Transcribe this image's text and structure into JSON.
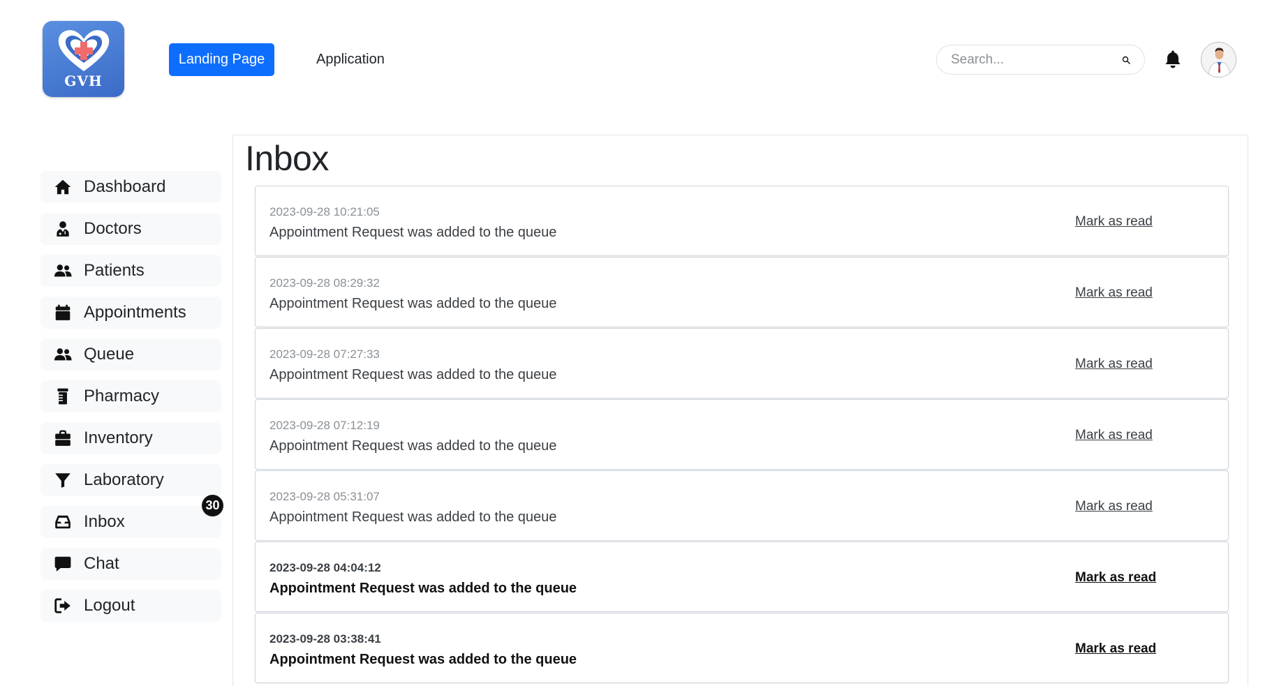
{
  "brand": {
    "logo_text": "GVH"
  },
  "topnav": {
    "landing_label": "Landing Page",
    "application_label": "Application"
  },
  "search": {
    "placeholder": "Search..."
  },
  "sidebar": {
    "items": [
      {
        "label": "Dashboard",
        "icon": "home-icon"
      },
      {
        "label": "Doctors",
        "icon": "doctor-icon"
      },
      {
        "label": "Patients",
        "icon": "users-icon"
      },
      {
        "label": "Appointments",
        "icon": "calendar-icon"
      },
      {
        "label": "Queue",
        "icon": "users-icon"
      },
      {
        "label": "Pharmacy",
        "icon": "prescription-bottle-icon"
      },
      {
        "label": "Inventory",
        "icon": "box-icon"
      },
      {
        "label": "Laboratory",
        "icon": "filter-icon"
      },
      {
        "label": "Inbox",
        "icon": "inbox-icon",
        "badge": "30"
      },
      {
        "label": "Chat",
        "icon": "comment-icon"
      },
      {
        "label": "Logout",
        "icon": "sign-out-icon"
      }
    ]
  },
  "main": {
    "title": "Inbox",
    "messages": [
      {
        "time": "2023-09-28 10:21:05",
        "text": "Appointment Request was added to the queue",
        "action": "Mark as read",
        "state": "read"
      },
      {
        "time": "2023-09-28 08:29:32",
        "text": "Appointment Request was added to the queue",
        "action": "Mark as read",
        "state": "read"
      },
      {
        "time": "2023-09-28 07:27:33",
        "text": "Appointment Request was added to the queue",
        "action": "Mark as read",
        "state": "read"
      },
      {
        "time": "2023-09-28 07:12:19",
        "text": "Appointment Request was added to the queue",
        "action": "Mark as read",
        "state": "read"
      },
      {
        "time": "2023-09-28 05:31:07",
        "text": "Appointment Request was added to the queue",
        "action": "Mark as read",
        "state": "read"
      },
      {
        "time": "2023-09-28 04:04:12",
        "text": "Appointment Request was added to the queue",
        "action": "Mark as read",
        "state": "unread"
      },
      {
        "time": "2023-09-28 03:38:41",
        "text": "Appointment Request was added to the queue",
        "action": "Mark as read",
        "state": "unread"
      }
    ]
  },
  "colors": {
    "primary": "#0d6efd",
    "logo_bg": "#4a7fd6",
    "badge_bg": "#111111"
  }
}
